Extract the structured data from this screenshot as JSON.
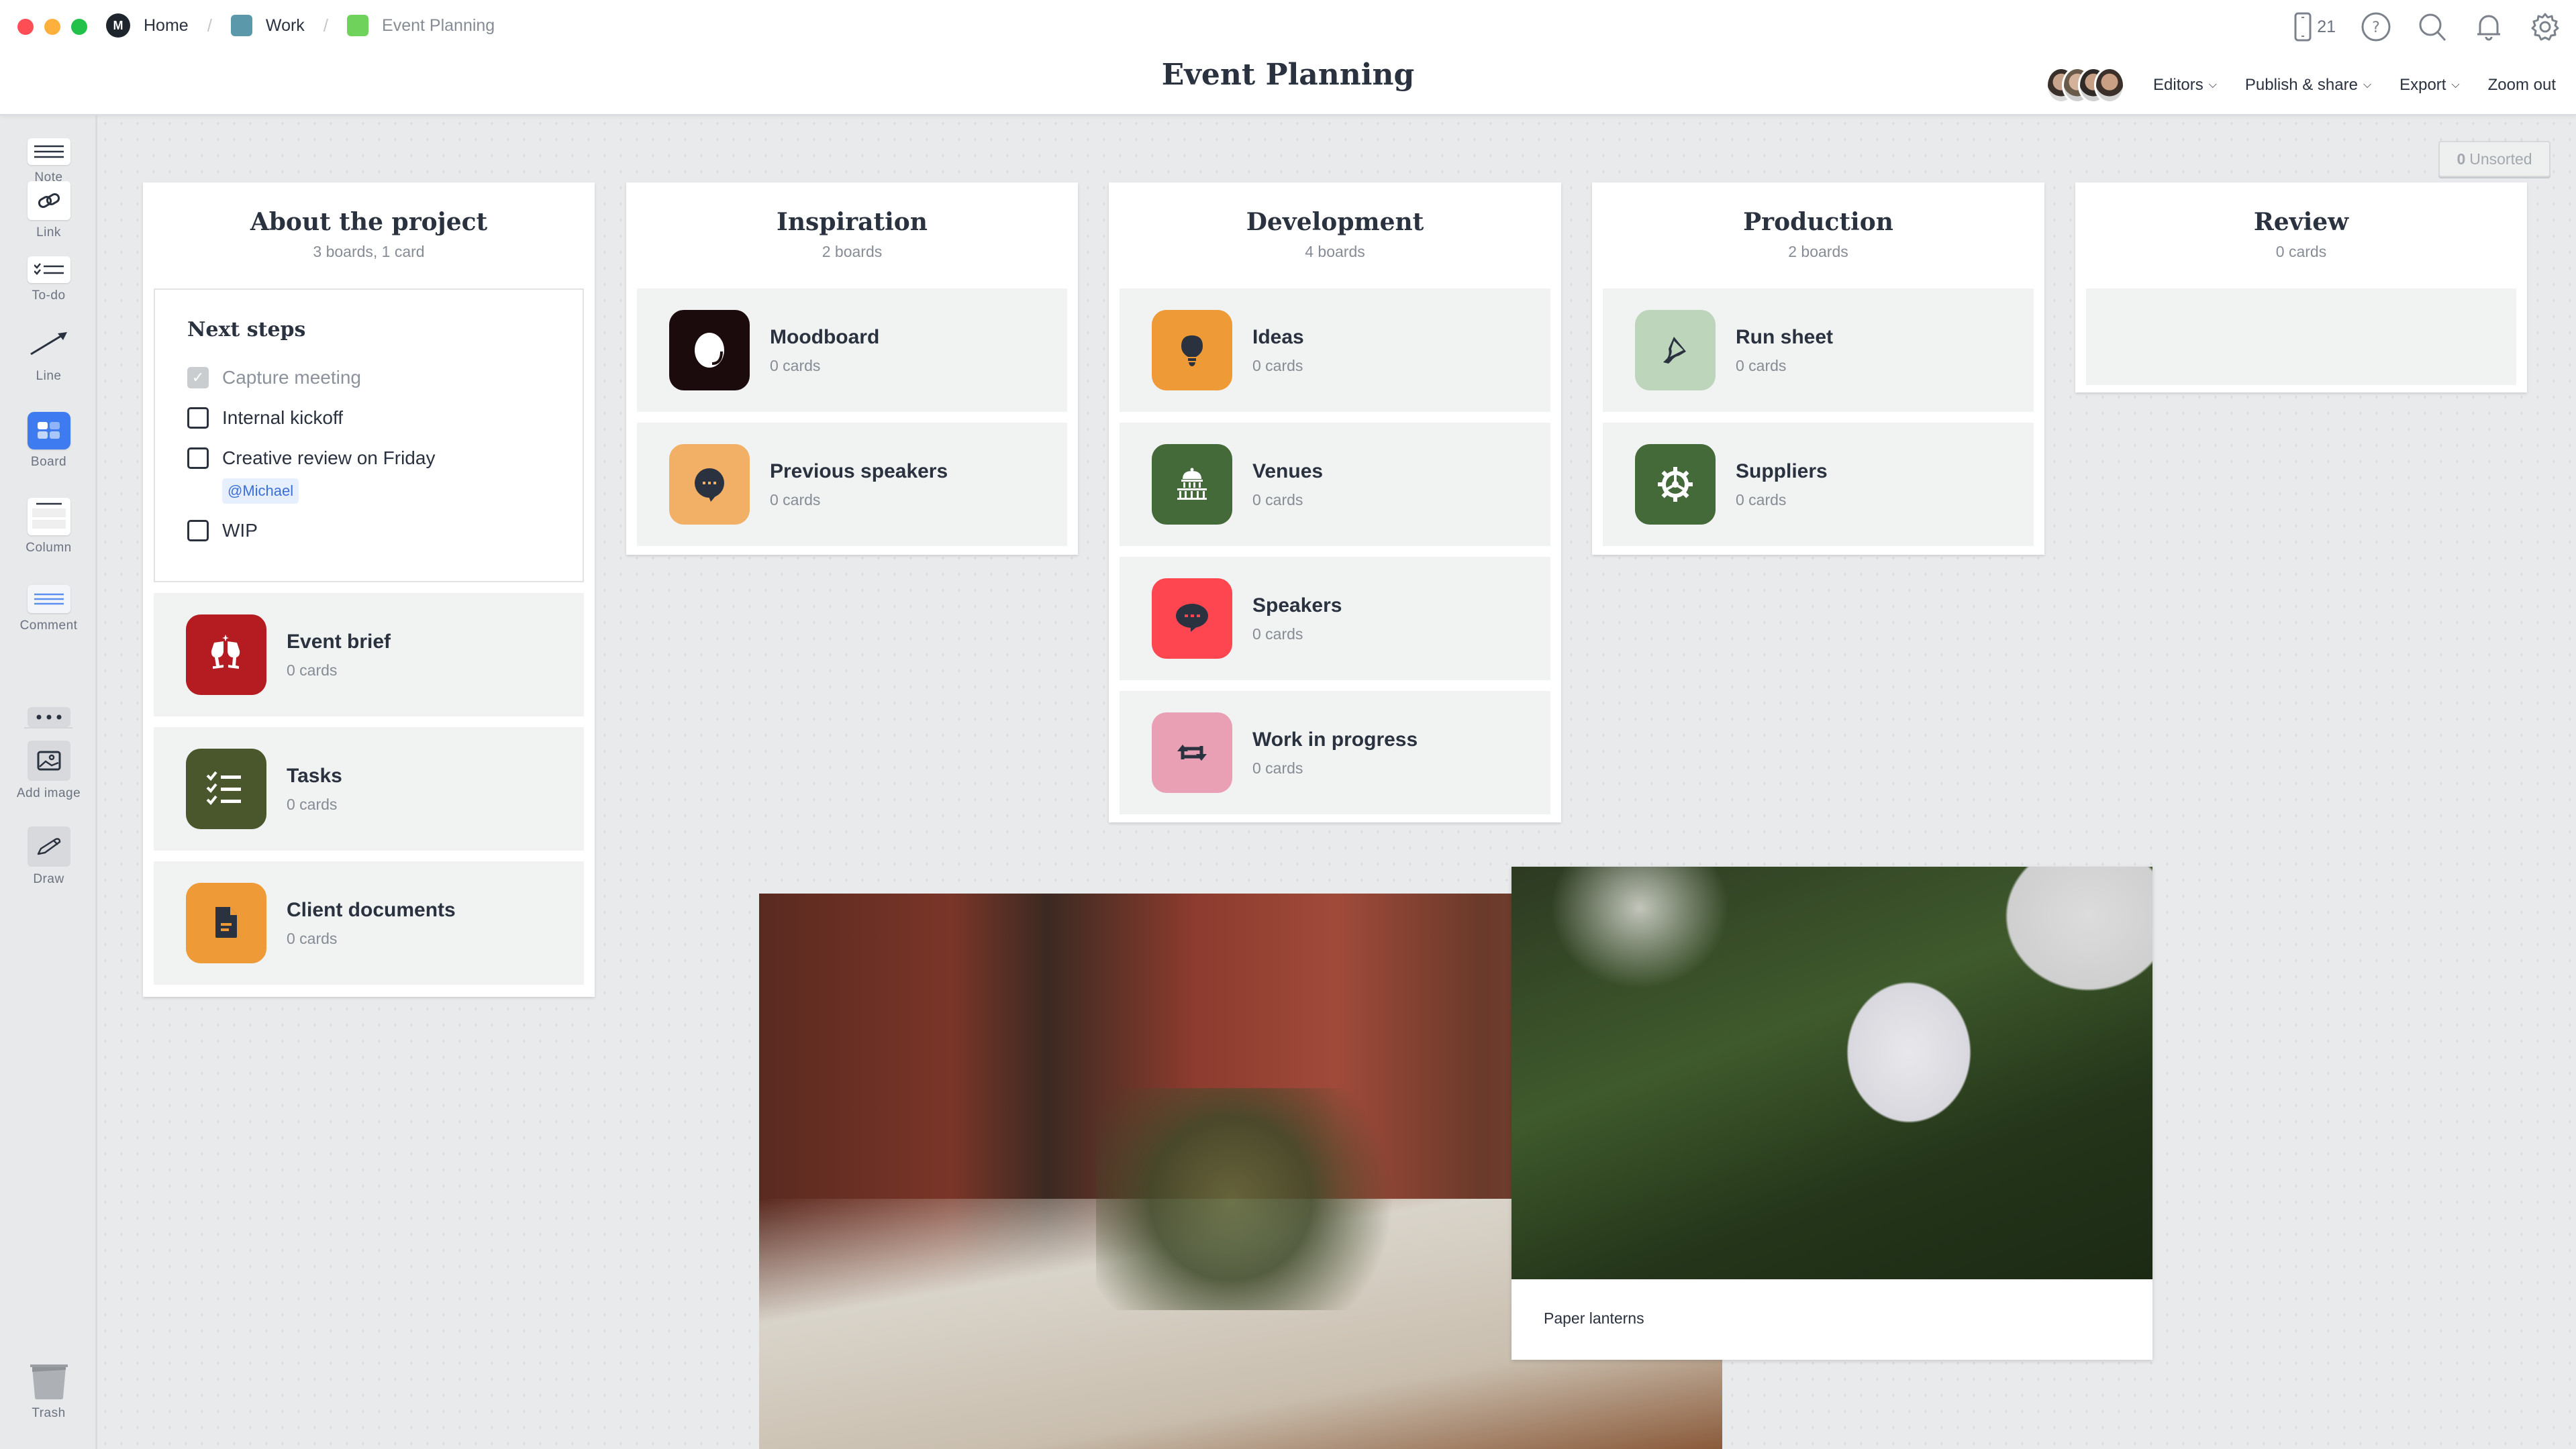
{
  "window": {
    "traffic_lights": {
      "close": "#fe4d54",
      "minimize": "#fdb03c",
      "maximize": "#22c24a"
    }
  },
  "breadcrumb": [
    {
      "label": "Home",
      "icon": "milanote-logo-icon"
    },
    {
      "label": "Work",
      "icon": "board-icon",
      "color": "#5b99aa"
    },
    {
      "label": "Event Planning",
      "icon": "board-icon",
      "color": "#6fd25a"
    }
  ],
  "header": {
    "title": "Event Planning",
    "device_count": "21",
    "menus": {
      "editors": "Editors",
      "publish": "Publish & share",
      "export": "Export",
      "zoom_out": "Zoom out"
    }
  },
  "toolbar": {
    "items": [
      {
        "label": "Note",
        "icon": "note-icon"
      },
      {
        "label": "Link",
        "icon": "link-icon"
      },
      {
        "label": "To-do",
        "icon": "todo-icon"
      },
      {
        "label": "Line",
        "icon": "line-arrow-icon"
      },
      {
        "label": "Board",
        "icon": "board-icon"
      },
      {
        "label": "Column",
        "icon": "column-icon"
      },
      {
        "label": "Comment",
        "icon": "comment-icon"
      },
      {
        "label": "",
        "icon": "more-icon"
      },
      {
        "label": "Add image",
        "icon": "image-icon"
      },
      {
        "label": "Draw",
        "icon": "pencil-icon"
      },
      {
        "label": "Trash",
        "icon": "trash-icon"
      }
    ]
  },
  "unsorted": {
    "count": "0",
    "label": "Unsorted"
  },
  "columns": [
    {
      "title": "About the project",
      "subtitle": "3 boards, 1 card",
      "todo": {
        "title": "Next steps",
        "items": [
          {
            "text": "Capture meeting",
            "checked": true
          },
          {
            "text": "Internal kickoff",
            "checked": false
          },
          {
            "text": "Creative review on Friday",
            "checked": false,
            "mention": "@Michael"
          },
          {
            "text": "WIP",
            "checked": false
          }
        ]
      },
      "boards": [
        {
          "name": "Event brief",
          "count": "0 cards",
          "color": "#b41c21",
          "icon": "cheers-glasses-icon"
        },
        {
          "name": "Tasks",
          "count": "0 cards",
          "color": "#4a572c",
          "icon": "checklist-icon"
        },
        {
          "name": "Client documents",
          "count": "0 cards",
          "color": "#ed9a37",
          "icon": "document-icon"
        }
      ]
    },
    {
      "title": "Inspiration",
      "subtitle": "2 boards",
      "boards": [
        {
          "name": "Moodboard",
          "count": "0 cards",
          "color": "#1b0b0d",
          "icon": "moodboard-icon"
        },
        {
          "name": "Previous speakers",
          "count": "0 cards",
          "color": "#f2b066",
          "icon": "speech-bubble-icon"
        }
      ]
    },
    {
      "title": "Development",
      "subtitle": "4 boards",
      "boards": [
        {
          "name": "Ideas",
          "count": "0 cards",
          "color": "#ed9a37",
          "icon": "lightbulb-icon"
        },
        {
          "name": "Venues",
          "count": "0 cards",
          "color": "#456a3a",
          "icon": "building-icon"
        },
        {
          "name": "Speakers",
          "count": "0 cards",
          "color": "#fe4650",
          "icon": "chat-bubble-icon"
        },
        {
          "name": "Work in progress",
          "count": "0 cards",
          "color": "#e99fb4",
          "icon": "repeat-icon"
        }
      ]
    },
    {
      "title": "Production",
      "subtitle": "2 boards",
      "boards": [
        {
          "name": "Run sheet",
          "count": "0 cards",
          "color": "#bcd5bb",
          "icon": "highlighter-icon"
        },
        {
          "name": "Suppliers",
          "count": "0 cards",
          "color": "#456a3a",
          "icon": "gear-icon"
        }
      ]
    },
    {
      "title": "Review",
      "subtitle": "0 cards",
      "boards": []
    }
  ],
  "images": [
    {
      "caption": "",
      "subject": "dining-table-photo"
    },
    {
      "caption": "Paper lanterns",
      "subject": "paper-lanterns-photo"
    }
  ]
}
